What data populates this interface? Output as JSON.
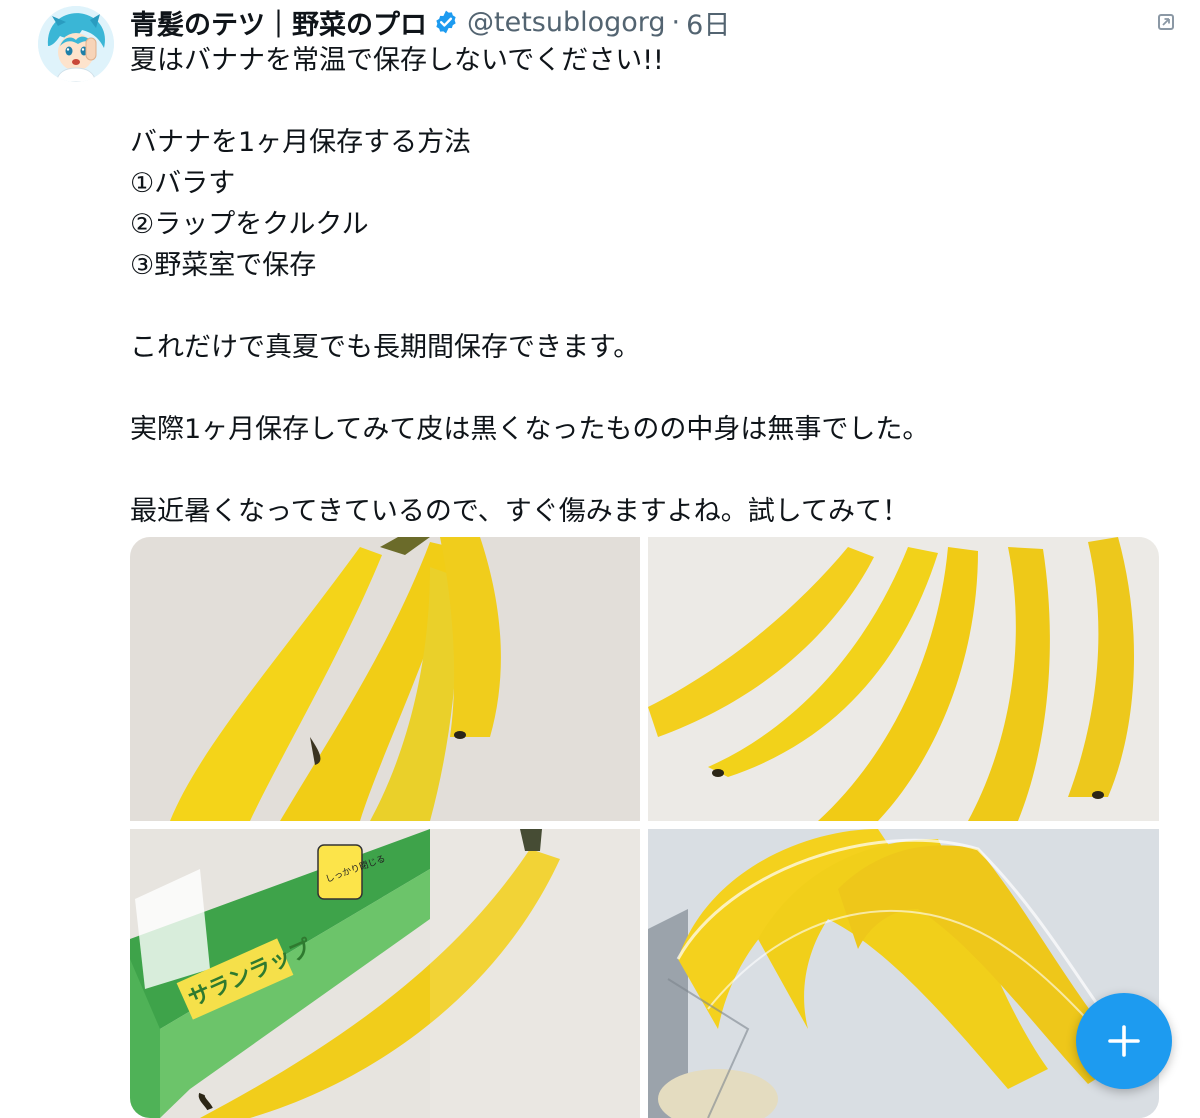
{
  "tweet": {
    "display_name": "青髪のテツ｜野菜のプロ",
    "handle": "@tetsublogorg",
    "separator": "·",
    "time": "6日",
    "verified_icon": "verified-badge-icon",
    "more_icon": "more-options-icon",
    "lines": [
      "夏はバナナを常温で保存しないでください!!",
      "",
      "バナナを1ヶ月保存する方法",
      "①バラす",
      "②ラップをクルクル",
      "③野菜室で保存",
      "",
      "これだけで真夏でも長期間保存できます。",
      "",
      "実際1ヶ月保存してみて皮は黒くなったものの中身は無事でした。",
      "",
      "最近暑くなってきているので、すぐ傷みますよね。試してみて！"
    ],
    "photos": {
      "wrap_box_label": "サランラップ",
      "wrap_box_badge": "しっかり閉じる"
    }
  },
  "fab": {
    "icon": "plus-icon"
  },
  "colors": {
    "accent": "#1d9bf0",
    "secondary_text": "#536471",
    "banana": "#f2cf1a"
  }
}
